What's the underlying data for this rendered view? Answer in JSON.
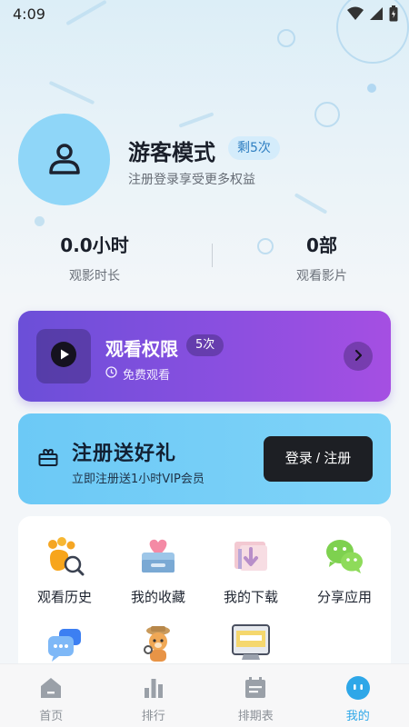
{
  "status_bar": {
    "time": "4:09"
  },
  "profile": {
    "name": "游客模式",
    "remain_badge": "剩5次",
    "subtitle": "注册登录享受更多权益"
  },
  "stats": [
    {
      "value": "0.0小时",
      "label": "观影时长"
    },
    {
      "value": "0部",
      "label": "观看影片"
    }
  ],
  "vip_card": {
    "title": "观看权限",
    "badge": "5次",
    "subtitle": "免费观看"
  },
  "register_card": {
    "title": "注册送好礼",
    "subtitle": "立即注册送1小时VIP会员",
    "button_label": "登录 / 注册"
  },
  "grid": {
    "items": [
      {
        "label": "观看历史",
        "icon": "history-icon"
      },
      {
        "label": "我的收藏",
        "icon": "favorites-icon"
      },
      {
        "label": "我的下载",
        "icon": "download-icon"
      },
      {
        "label": "分享应用",
        "icon": "share-icon"
      },
      {
        "label": "",
        "icon": "feedback-icon"
      },
      {
        "label": "",
        "icon": "mascot-icon"
      },
      {
        "label": "",
        "icon": "website-icon"
      }
    ]
  },
  "bottom_nav": {
    "items": [
      {
        "label": "首页",
        "icon": "home-icon"
      },
      {
        "label": "排行",
        "icon": "ranking-icon"
      },
      {
        "label": "排期表",
        "icon": "schedule-icon"
      },
      {
        "label": "我的",
        "icon": "profile-icon"
      }
    ],
    "active_index": 3
  },
  "colors": {
    "accent": "#2ea7e8",
    "vip_gradient_start": "#6b4fd8",
    "vip_gradient_end": "#a54fe2",
    "register_bg": "#7fd3f8",
    "avatar_bg": "#8fd6f8"
  }
}
